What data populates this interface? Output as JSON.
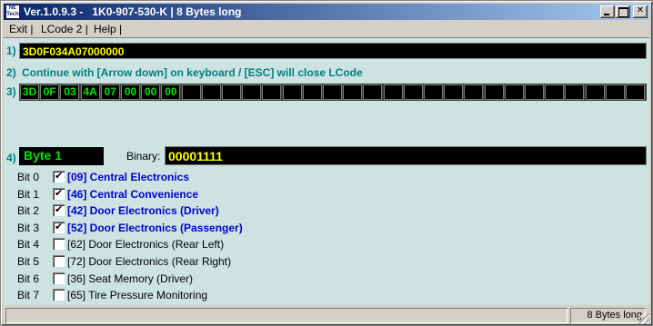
{
  "window": {
    "title": "Ver.1.0.9.3 -   1K0-907-530-K | 8 Bytes long",
    "logo_lines": [
      "NE",
      "Tech"
    ]
  },
  "menu": [
    "Exit |",
    "LCode 2 |",
    "Help |"
  ],
  "steps": {
    "s1": "1)",
    "s2": "2)",
    "s3": "3)",
    "s4": "4)"
  },
  "hex_value": "3D0F034A07000000",
  "instruction": "Continue with [Arrow down] on keyboard / [ESC] will close LCode",
  "bytes": [
    "3D",
    "0F",
    "03",
    "4A",
    "07",
    "00",
    "00",
    "00",
    "",
    "",
    "",
    "",
    "",
    "",
    "",
    "",
    "",
    "",
    "",
    "",
    "",
    "",
    "",
    "",
    "",
    "",
    "",
    "",
    "",
    "",
    ""
  ],
  "byte_selector": "Byte 1",
  "binary_label": "Binary:",
  "binary_value": "00001111",
  "bits": [
    {
      "label": "Bit 0",
      "checked": true,
      "text": "[09] Central Electronics"
    },
    {
      "label": "Bit 1",
      "checked": true,
      "text": "[46] Central Convenience"
    },
    {
      "label": "Bit 2",
      "checked": true,
      "text": "[42] Door Electronics (Driver)"
    },
    {
      "label": "Bit 3",
      "checked": true,
      "text": "[52] Door Electronics (Passenger)"
    },
    {
      "label": "Bit 4",
      "checked": false,
      "text": "[62] Door Electronics (Rear Left)"
    },
    {
      "label": "Bit 5",
      "checked": false,
      "text": "[72] Door Electronics (Rear Right)"
    },
    {
      "label": "Bit 6",
      "checked": false,
      "text": "[36] Seat Memory (Driver)"
    },
    {
      "label": "Bit 7",
      "checked": false,
      "text": "[65] Tire Pressure Monitoring"
    }
  ],
  "status": {
    "left": "",
    "right": "8 Bytes long"
  },
  "colors": {
    "client_bg": "#cde3e1",
    "accent_teal": "#008080",
    "active_bit": "#0000cc",
    "hex_text": "#ffff00",
    "byte_text": "#00e600"
  }
}
